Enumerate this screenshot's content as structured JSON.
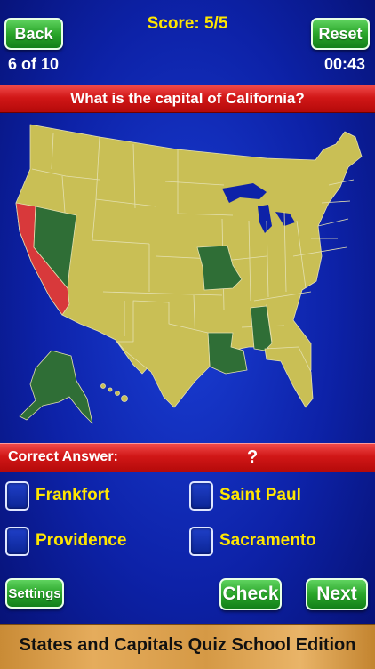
{
  "header": {
    "back_label": "Back",
    "reset_label": "Reset",
    "score": "Score: 5/5",
    "progress": "6 of 10",
    "timer": "00:43"
  },
  "question": "What is the capital of California?",
  "answer": {
    "label": "Correct Answer:",
    "value": "?"
  },
  "choices": [
    "Frankfort",
    "Saint Paul",
    "Providence",
    "Sacramento"
  ],
  "bottom": {
    "settings_label": "Settings",
    "check_label": "Check",
    "next_label": "Next"
  },
  "footer_title": "States and Capitals Quiz School Edition",
  "colors": {
    "background": "#0d22a8",
    "map_default": "#c9bf55",
    "map_highlight": "#d8393b",
    "map_correct": "#2f6e36",
    "score_text": "#ffe600",
    "button_green": "#2aa52a",
    "bar_red": "#d11717"
  },
  "map": {
    "highlighted_state": "California",
    "answered_states": [
      "Nevada",
      "Missouri",
      "Louisiana",
      "Alabama",
      "Alaska"
    ]
  }
}
